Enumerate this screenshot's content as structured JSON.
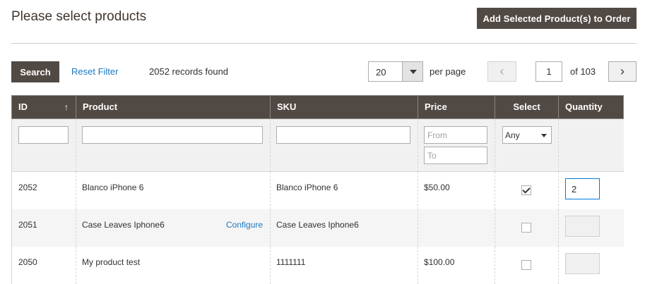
{
  "header": {
    "title": "Please select products",
    "add_button": "Add Selected Product(s) to Order"
  },
  "toolbar": {
    "search_label": "Search",
    "reset_label": "Reset Filter",
    "records_found": "2052 records found",
    "per_page_value": "20",
    "per_page_label": "per page",
    "prev_icon": "‹",
    "current_page": "1",
    "of_pages": "of 103",
    "next_icon": "›"
  },
  "grid": {
    "columns": [
      "ID",
      "Product",
      "SKU",
      "Price",
      "Select",
      "Quantity"
    ],
    "sort_icon": "↑",
    "filters": {
      "price_from_placeholder": "From",
      "price_to_placeholder": "To",
      "select_value": "Any"
    },
    "rows": [
      {
        "id": "2052",
        "product": "Blanco iPhone 6",
        "configure": "",
        "sku": "Blanco iPhone 6",
        "price": "$50.00",
        "selected": true,
        "qty": "2"
      },
      {
        "id": "2051",
        "product": "Case Leaves Iphone6",
        "configure": "Configure",
        "sku": "Case Leaves Iphone6",
        "price": "",
        "selected": false,
        "qty": ""
      },
      {
        "id": "2050",
        "product": "My product test",
        "configure": "",
        "sku": "1111111",
        "price": "$100.00",
        "selected": false,
        "qty": ""
      }
    ]
  }
}
